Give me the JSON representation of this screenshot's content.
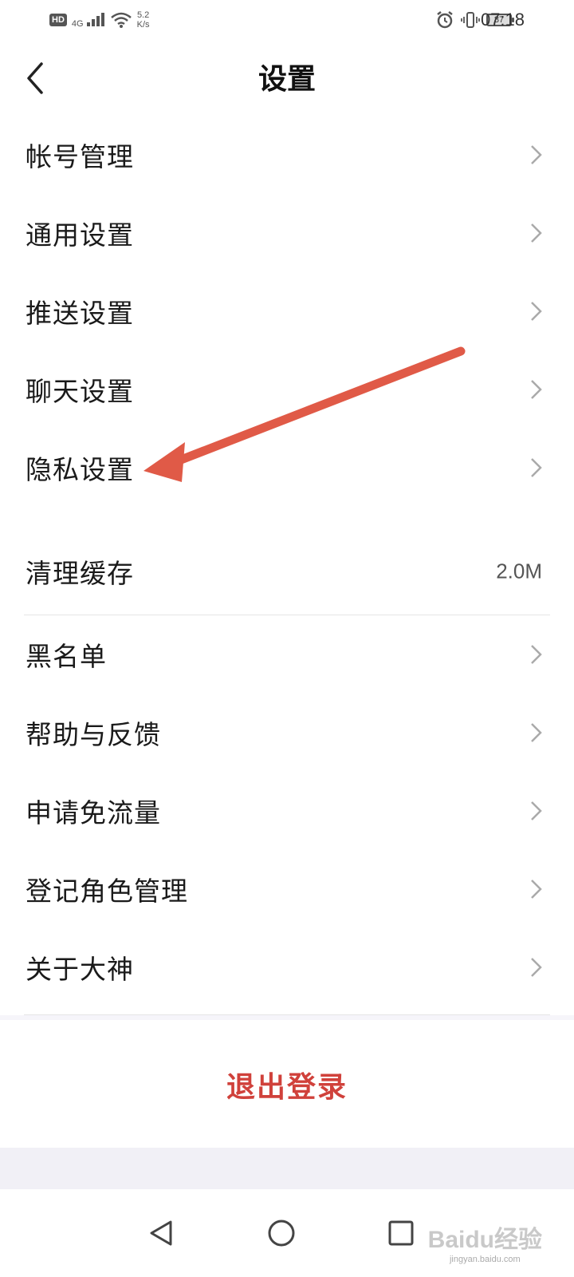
{
  "status_bar": {
    "network_badge": "HD",
    "signal_label": "4G",
    "speed_value": "5.2",
    "speed_unit": "K/s",
    "battery": "87",
    "time": "07:18"
  },
  "header": {
    "title": "设置"
  },
  "menu": {
    "items": [
      {
        "label": "帐号管理"
      },
      {
        "label": "通用设置"
      },
      {
        "label": "推送设置"
      },
      {
        "label": "聊天设置"
      },
      {
        "label": "隐私设置"
      }
    ],
    "cache": {
      "label": "清理缓存",
      "value": "2.0M"
    },
    "items2": [
      {
        "label": "黑名单"
      },
      {
        "label": "帮助与反馈"
      },
      {
        "label": "申请免流量"
      },
      {
        "label": "登记角色管理"
      },
      {
        "label": "关于大神"
      }
    ]
  },
  "logout": {
    "label": "退出登录"
  },
  "annotation": {
    "arrow_color": "#e05a47"
  },
  "colors": {
    "logout": "#d0413b",
    "background": "#f6f5fa"
  },
  "icons": {
    "back": "chevron-left-icon",
    "row": "chevron-right-icon",
    "nav_back": "triangle-back-icon",
    "nav_home": "circle-home-icon",
    "nav_recent": "square-recent-icon"
  },
  "watermark": {
    "main": "Baidu经验",
    "sub": "jingyan.baidu.com"
  }
}
